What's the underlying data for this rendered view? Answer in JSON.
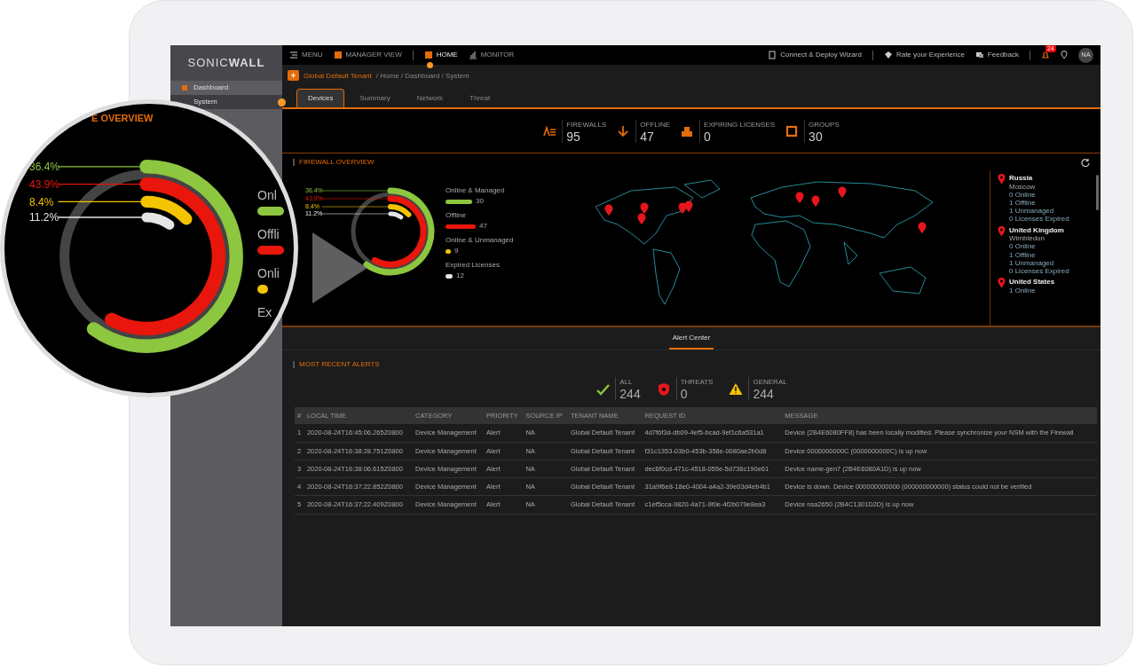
{
  "sidebar": {
    "logo": {
      "left": "SONIC",
      "right": "WALL"
    },
    "items": [
      {
        "label": "Dashboard",
        "selected": false
      },
      {
        "label": "System",
        "selected": true
      }
    ]
  },
  "topbar": {
    "left": [
      {
        "kind": "menu",
        "label": "MENU"
      },
      {
        "kind": "manager",
        "label": "MANAGER VIEW"
      },
      {
        "kind": "home",
        "label": "HOME",
        "selected": true
      },
      {
        "kind": "monitor",
        "label": "MONITOR",
        "selected": false
      }
    ],
    "right": [
      {
        "kind": "wizard",
        "label": "Connect & Deploy Wizard"
      },
      {
        "kind": "rate",
        "label": "Rate your Experience"
      },
      {
        "kind": "feedback",
        "label": "Feedback"
      }
    ],
    "alerts_badge": "24",
    "avatar": "NA"
  },
  "breadcrumb": {
    "tenant": "Global Default Tenant",
    "path": "/ Home / Dashboard / System"
  },
  "tabs": [
    {
      "label": "Devices",
      "selected": true
    },
    {
      "label": "Summary",
      "selected": false
    },
    {
      "label": "Network",
      "selected": false
    },
    {
      "label": "Threat",
      "selected": false
    }
  ],
  "stats": [
    {
      "kind": "firewalls",
      "label": "FIREWALLS",
      "value": "95"
    },
    {
      "kind": "offline",
      "label": "OFFLINE",
      "value": "47"
    },
    {
      "kind": "licenses",
      "label": "EXPIRING LICENSES",
      "value": "0"
    },
    {
      "kind": "groups",
      "label": "GROUPS",
      "value": "30"
    }
  ],
  "overview": {
    "title": "FIREWALL OVERVIEW",
    "rings": [
      {
        "label": "36.4%",
        "color": "#8dc63f"
      },
      {
        "label": "43.9%",
        "color": "#e8160c"
      },
      {
        "label": "8.4%",
        "color": "#f5c400"
      },
      {
        "label": "11.2%",
        "color": "#e6e6e6"
      }
    ],
    "legend": [
      {
        "label": "Online & Managed",
        "count": "30",
        "color": "#8dc63f"
      },
      {
        "label": "Offline",
        "count": "47",
        "color": "#e8160c"
      },
      {
        "label": "Online & Unmanaged",
        "count": "9",
        "color": "#f5c400"
      },
      {
        "label": "Expired Licenses",
        "count": "12",
        "color": "#e6e6e6"
      }
    ],
    "locations": [
      {
        "country": "Russia",
        "city": "Moscow",
        "lines": [
          "0 Online",
          "1 Offline",
          "1 Unmanaged",
          "0 Licenses Expired"
        ]
      },
      {
        "country": "United Kingdom",
        "city": "Wimbledon",
        "lines": [
          "0 Online",
          "1 Offline",
          "1 Unmanaged",
          "0 Licenses Expired"
        ]
      },
      {
        "country": "United States",
        "lines": [
          "1 Online"
        ]
      }
    ]
  },
  "alert_tabs": [
    {
      "label": "Alert Center",
      "selected": true
    }
  ],
  "alerts": {
    "title": "MOST RECENT ALERTS",
    "counts": [
      {
        "kind": "all",
        "label": "ALL",
        "value": "244"
      },
      {
        "kind": "threats",
        "label": "THREATS",
        "value": "0"
      },
      {
        "kind": "general",
        "label": "GENERAL",
        "value": "244"
      }
    ],
    "columns": [
      "#",
      "LOCAL TIME",
      "CATEGORY",
      "PRIORITY",
      "SOURCE IP",
      "TENANT NAME",
      "REQUEST ID",
      "MESSAGE"
    ],
    "rows": [
      [
        "1",
        "2020-08-24T16:45:06.265Z0800",
        "Device Management",
        "Alert",
        "NA",
        "Global Default Tenant",
        "4d7f6f3d-db09-4ef5-bcad-9ef1c6a531a1",
        "Device (2B4E6080FF8) has been locally modified. Please synchronize your NSM with the Firewall"
      ],
      [
        "2",
        "2020-08-24T16:38:28.751Z0800",
        "Device Management",
        "Alert",
        "NA",
        "Global Default Tenant",
        "f31c1353-03b0-453b-358e-0080ae2b0d8",
        "Device 0000000000C (0000000000C) is up now"
      ],
      [
        "3",
        "2020-08-24T16:38:06.615Z0800",
        "Device Management",
        "Alert",
        "NA",
        "Global Default Tenant",
        "dec6f0cd-471c-4518-055e-5d736c190e61",
        "Device name-gen7 (2B4E6080A1D) is up now"
      ],
      [
        "4",
        "2020-08-24T16:37:22.852Z0800",
        "Device Management",
        "Alert",
        "NA",
        "Global Default Tenant",
        "31a9f6e8-18e0-4004-a4a2-39e03d4eb4b1",
        "Device is down. Device 000000000000 (000000000000) status could not be verified"
      ],
      [
        "5",
        "2020-08-24T16:37:22.409Z0800",
        "Device Management",
        "Alert",
        "NA",
        "Global Default Tenant",
        "c1ef5cca-9820-4a71-9f0e-4f2b079e8ea3",
        "Device nsa2650 (2B4C1301D2D) is up now"
      ]
    ]
  },
  "magnifier": {
    "title": "E OVERVIEW",
    "rings": [
      {
        "label": "36.4%",
        "color": "#8dc63f"
      },
      {
        "label": "43.9%",
        "color": "#e8160c"
      },
      {
        "label": "8.4%",
        "color": "#f5c400"
      },
      {
        "label": "11.2%",
        "color": "#e6e6e6"
      }
    ],
    "legend": [
      {
        "label": "Onl",
        "color": "#8dc63f"
      },
      {
        "label": "Offli",
        "color": "#e8160c"
      },
      {
        "label": "Onli",
        "color": "#f5c400"
      },
      {
        "label": "Ex"
      }
    ]
  }
}
